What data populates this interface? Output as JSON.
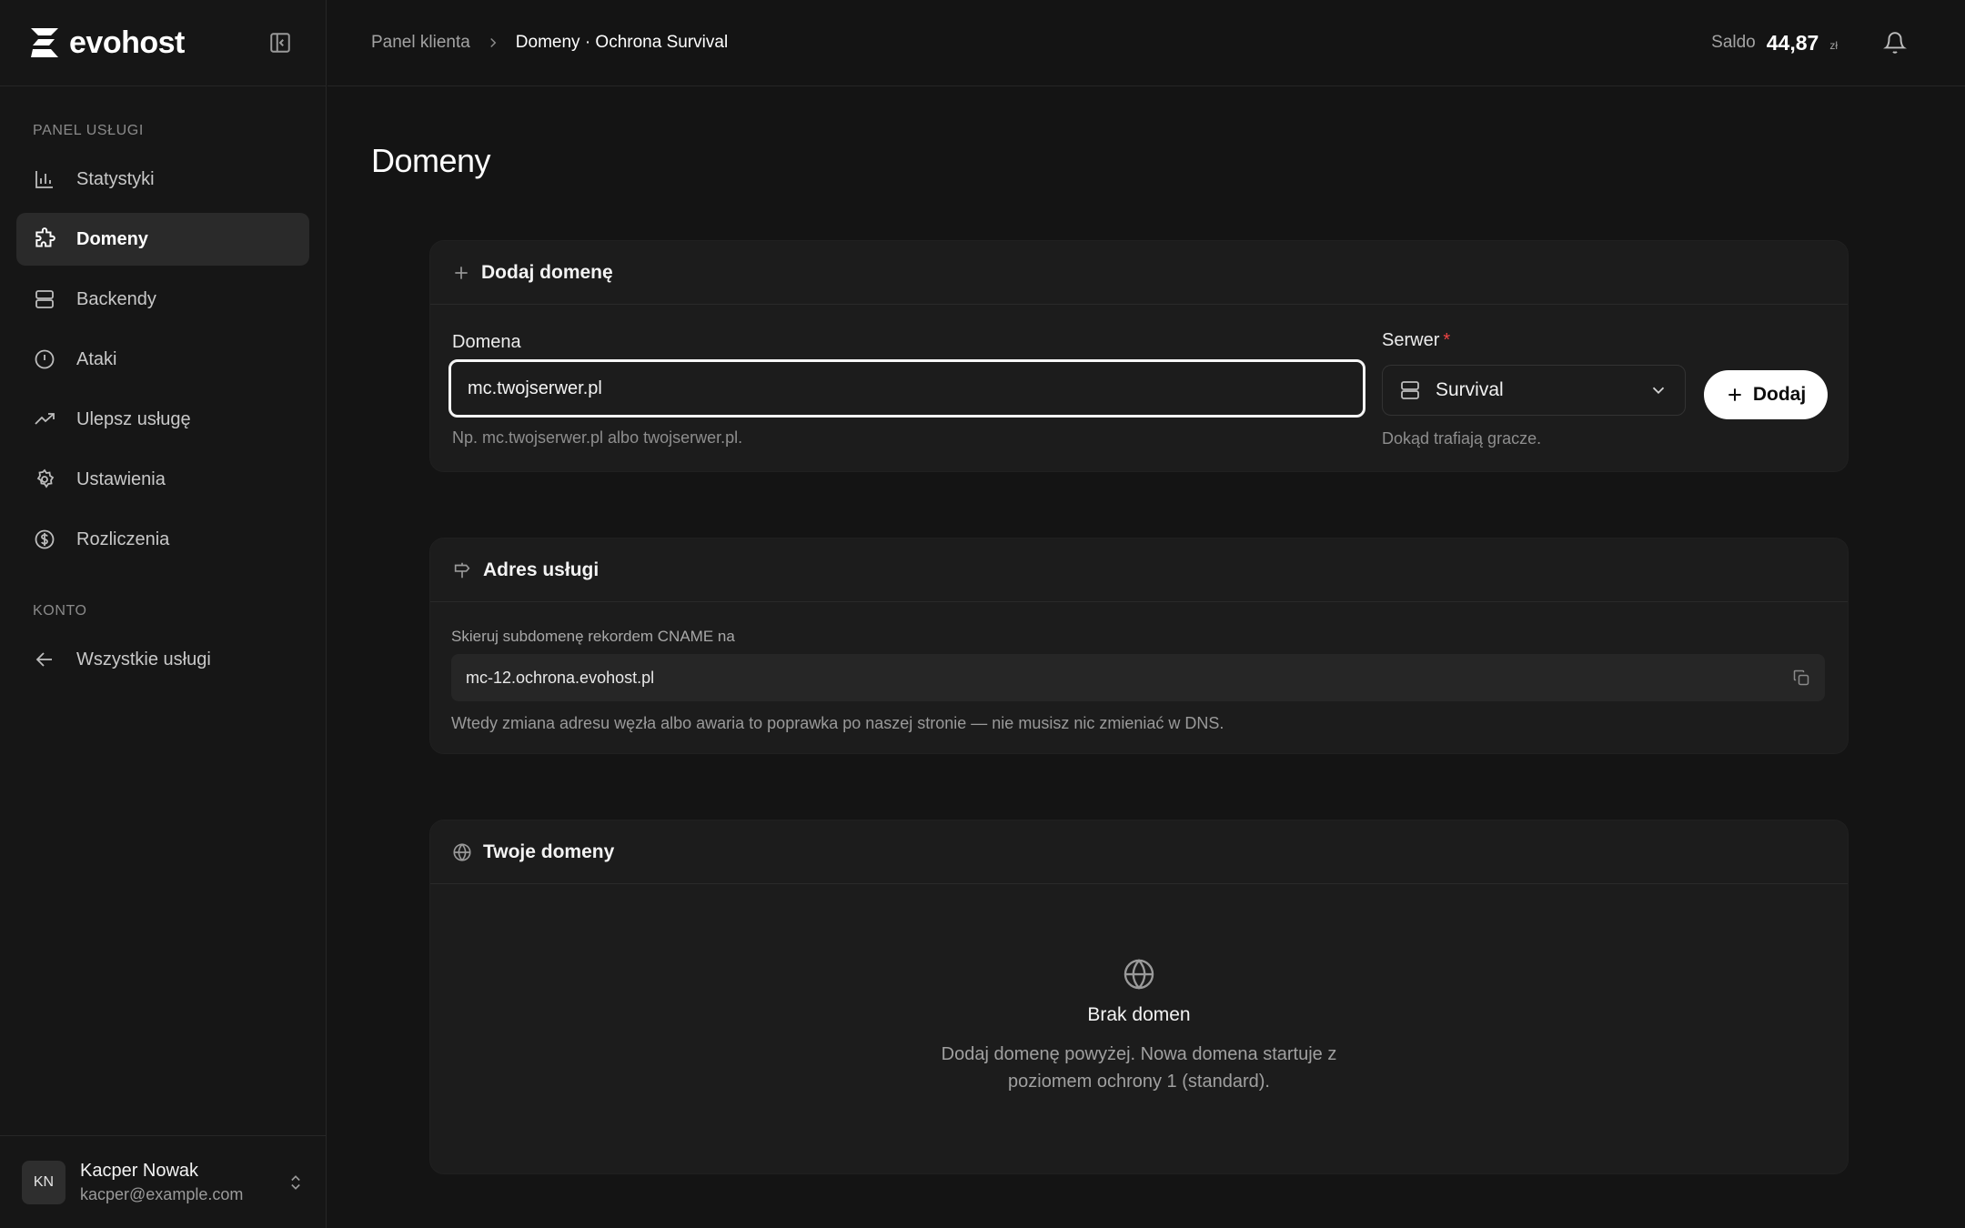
{
  "brand": {
    "name": "evohost"
  },
  "sidebar": {
    "section_service": "PANEL USŁUGI",
    "items": [
      {
        "label": "Statystyki",
        "icon": "bar-chart-icon",
        "active": false
      },
      {
        "label": "Domeny",
        "icon": "puzzle-icon",
        "active": true
      },
      {
        "label": "Backendy",
        "icon": "server-icon",
        "active": false
      },
      {
        "label": "Ataki",
        "icon": "alert-circle-icon",
        "active": false
      },
      {
        "label": "Ulepsz usługę",
        "icon": "trending-up-icon",
        "active": false
      },
      {
        "label": "Ustawienia",
        "icon": "gear-icon",
        "active": false
      },
      {
        "label": "Rozliczenia",
        "icon": "dollar-circle-icon",
        "active": false
      }
    ],
    "section_account": "KONTO",
    "account_items": [
      {
        "label": "Wszystkie usługi",
        "icon": "arrow-left-icon"
      }
    ],
    "user": {
      "initials": "KN",
      "name": "Kacper Nowak",
      "email": "kacper@example.com"
    }
  },
  "topbar": {
    "breadcrumb": {
      "root": "Panel klienta",
      "current": "Domeny · Ochrona Survival"
    },
    "balance": {
      "label": "Saldo",
      "value": "44,87",
      "currency": "zł"
    }
  },
  "page": {
    "title": "Domeny"
  },
  "add_domain": {
    "title": "Dodaj domenę",
    "domain_label": "Domena",
    "domain_value": "mc.twojserwer.pl",
    "domain_hint": "Np. mc.twojserwer.pl albo twojserwer.pl.",
    "server_label": "Serwer",
    "server_required": "*",
    "server_value": "Survival",
    "server_hint": "Dokąd trafiają gracze.",
    "add_button": "Dodaj"
  },
  "service_address": {
    "title": "Adres usługi",
    "cname_label": "Skieruj subdomenę rekordem CNAME na",
    "cname_value": "mc-12.ochrona.evohost.pl",
    "note": "Wtedy zmiana adresu węzła albo awaria to poprawka po naszej stronie — nie musisz nic zmieniać w DNS."
  },
  "your_domains": {
    "title": "Twoje domeny",
    "empty_title": "Brak domen",
    "empty_desc": "Dodaj domenę powyżej. Nowa domena startuje z poziomem ochrony 1 (standard)."
  }
}
